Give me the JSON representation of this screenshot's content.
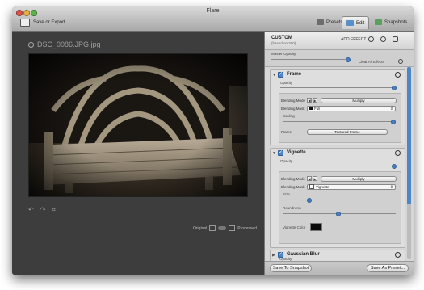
{
  "window": {
    "title": "Flare",
    "toolbar": {
      "save_export_label": "Save or Export",
      "tabs": [
        {
          "label": "Presets",
          "icon": "presets-icon"
        },
        {
          "label": "Edit",
          "icon": "edit-icon"
        },
        {
          "label": "Snapshots",
          "icon": "snapshots-icon"
        }
      ],
      "active_tab": "Edit"
    }
  },
  "canvas": {
    "filename": "DSC_0086.JPG.jpg",
    "original_label": "Original",
    "processed_label": "Processed"
  },
  "panel": {
    "header": {
      "title": "CUSTOM",
      "subtitle": "(based on 300)",
      "add_effect": "ADD EFFECT"
    },
    "master": {
      "label": "Master Opacity",
      "clear_label": "Clear All Effects"
    },
    "frame": {
      "title": "Frame",
      "opacity_label": "Opacity",
      "blending_mode_label": "Blending Mode",
      "blending_mode_value": "Multiply",
      "blending_mask_label": "Blending Mask",
      "blending_mask_value": "Full",
      "scaling_label": "Scaling",
      "frame_label": "Frame",
      "frame_value": "Textured Frame"
    },
    "vignette": {
      "title": "Vignette",
      "opacity_label": "Opacity",
      "blending_mode_label": "Blending Mode",
      "blending_mode_value": "Multiply",
      "blending_mask_label": "Blending Mask",
      "blending_mask_value": "Vignette",
      "size_label": "Size",
      "roundness_label": "Roundness",
      "color_label": "Vignette Color"
    },
    "gaussian": {
      "title": "Gaussian Blur",
      "opacity_label": "Opacity"
    },
    "footer": {
      "save_snapshot": "Save To Snapshot",
      "save_preset": "Save As Preset..."
    }
  },
  "colors": {
    "accent": "#4c86c8",
    "canvas_bg": "#3d3d3d",
    "panel_bg": "#d6d6d6"
  }
}
